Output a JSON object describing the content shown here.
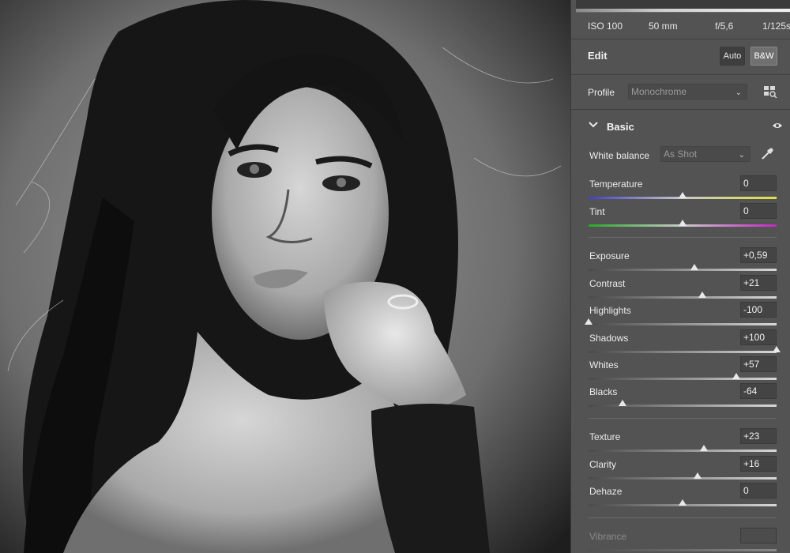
{
  "exif": {
    "iso": "ISO 100",
    "focal": "50 mm",
    "aperture": "f/5,6",
    "shutter": "1/125s"
  },
  "edit": {
    "title": "Edit",
    "auto_label": "Auto",
    "bw_label": "B&W"
  },
  "profile": {
    "label": "Profile",
    "value": "Monochrome"
  },
  "basic": {
    "title": "Basic",
    "white_balance_label": "White balance",
    "white_balance_value": "As Shot"
  },
  "sliders": [
    {
      "name": "Temperature",
      "value": "0",
      "position": 0.5
    },
    {
      "name": "Tint",
      "value": "0",
      "position": 0.5
    },
    {
      "name": "Exposure",
      "value": "+0,59",
      "position": 0.565
    },
    {
      "name": "Contrast",
      "value": "+21",
      "position": 0.605
    },
    {
      "name": "Highlights",
      "value": "-100",
      "position": 0.0
    },
    {
      "name": "Shadows",
      "value": "+100",
      "position": 1.0
    },
    {
      "name": "Whites",
      "value": "+57",
      "position": 0.785
    },
    {
      "name": "Blacks",
      "value": "-64",
      "position": 0.18
    },
    {
      "name": "Texture",
      "value": "+23",
      "position": 0.615
    },
    {
      "name": "Clarity",
      "value": "+16",
      "position": 0.58
    },
    {
      "name": "Dehaze",
      "value": "0",
      "position": 0.5
    },
    {
      "name": "Vibrance",
      "value": "",
      "position": 0.5
    }
  ],
  "colors": {
    "panel_bg": "#535353",
    "active_button": "#707070"
  }
}
